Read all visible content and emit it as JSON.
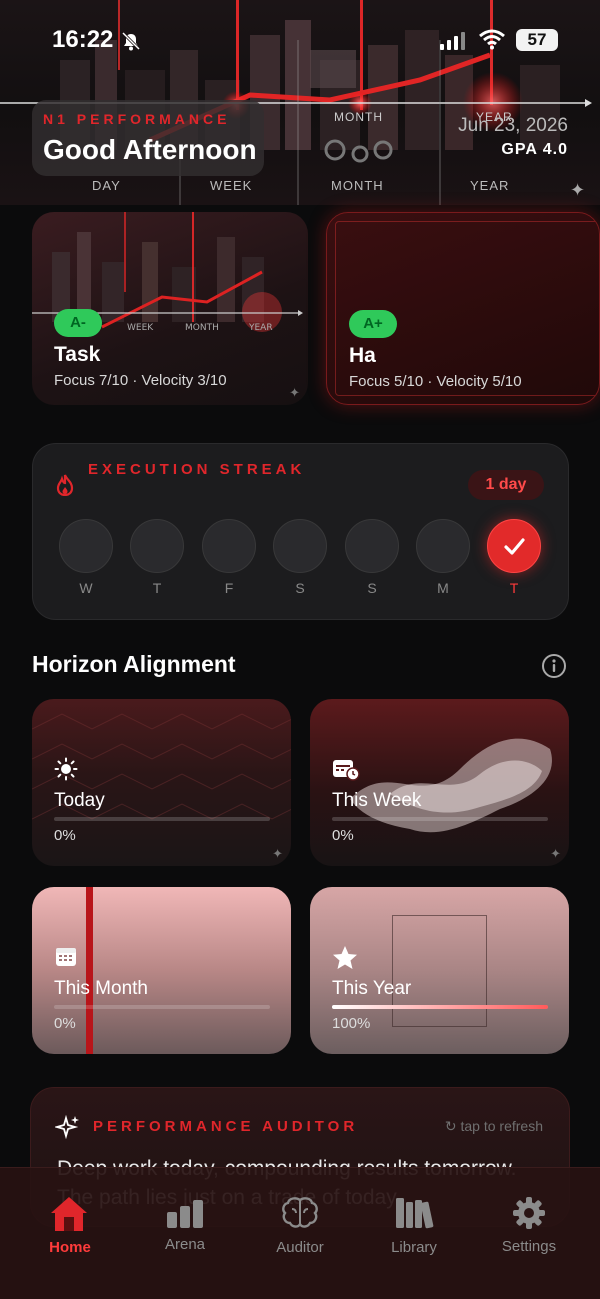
{
  "status_bar": {
    "time": "16:22",
    "battery": "57"
  },
  "hero": {
    "brand": "N1 PERFORMANCE",
    "greeting": "Good Afternoon",
    "date": "Jun 23, 2026",
    "gpa": "GPA 4.0",
    "scale_labels": [
      "DAY",
      "WEEK",
      "MONTH",
      "YEAR"
    ],
    "month_top": "MONTH",
    "year_top": "YEAR"
  },
  "tasks": [
    {
      "grade": "A-",
      "name": "Task",
      "metrics": "Focus 7/10 · Velocity 3/10"
    },
    {
      "grade": "A+",
      "name": "Ha",
      "metrics": "Focus 5/10 · Velocity 5/10"
    }
  ],
  "streak": {
    "title": "EXECUTION STREAK",
    "badge": "1 day",
    "days": [
      {
        "label": "W",
        "done": false
      },
      {
        "label": "T",
        "done": false
      },
      {
        "label": "F",
        "done": false
      },
      {
        "label": "S",
        "done": false
      },
      {
        "label": "S",
        "done": false
      },
      {
        "label": "M",
        "done": false
      },
      {
        "label": "T",
        "done": true
      }
    ]
  },
  "horizon": {
    "title": "Horizon Alignment",
    "cards": [
      {
        "label": "Today",
        "percent": "0%",
        "progress": 0,
        "icon": "sun-icon"
      },
      {
        "label": "This Week",
        "percent": "0%",
        "progress": 0,
        "icon": "calendar-clock-icon"
      },
      {
        "label": "This Month",
        "percent": "0%",
        "progress": 0,
        "icon": "calendar-icon"
      },
      {
        "label": "This Year",
        "percent": "100%",
        "progress": 1.0,
        "icon": "star-icon"
      }
    ]
  },
  "auditor": {
    "title": "PERFORMANCE AUDITOR",
    "refresh": "tap to refresh",
    "text": "Deep work today, compounding results tomorrow. The path lies just on a trade of today."
  },
  "tabbar": {
    "items": [
      {
        "label": "Home",
        "icon": "home-icon",
        "active": true
      },
      {
        "label": "Arena",
        "icon": "bar-chart-icon",
        "active": false
      },
      {
        "label": "Auditor",
        "icon": "brain-icon",
        "active": false
      },
      {
        "label": "Library",
        "icon": "books-icon",
        "active": false
      },
      {
        "label": "Settings",
        "icon": "gear-icon",
        "active": false
      }
    ]
  },
  "colors": {
    "accent": "#e0262b",
    "badge_green": "#2fc95a",
    "background": "#0b0b0c"
  }
}
